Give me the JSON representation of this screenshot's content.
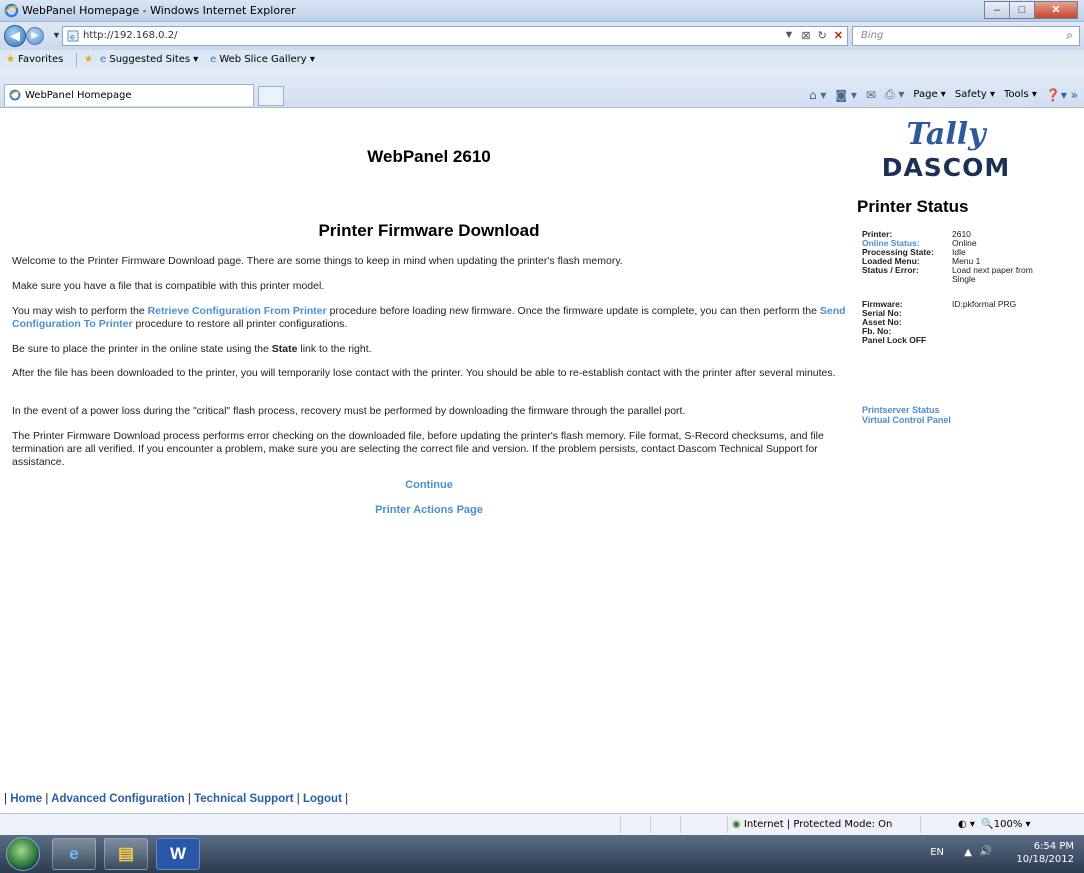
{
  "window": {
    "title": "WebPanel Homepage - Windows Internet Explorer",
    "min": "–",
    "max": "□",
    "close": "✕"
  },
  "address_bar": {
    "url": "http://192.168.0.2/",
    "search_placeholder": "Bing"
  },
  "favorites_bar": {
    "favorites": "Favorites",
    "suggested": "Suggested Sites ▾",
    "slice": "Web Slice Gallery ▾"
  },
  "tab": {
    "label": "WebPanel Homepage"
  },
  "command_bar": {
    "page": "Page ▾",
    "safety": "Safety ▾",
    "tools": "Tools ▾"
  },
  "main": {
    "title": "WebPanel 2610",
    "heading": "Printer Firmware Download",
    "p1": "Welcome to the Printer Firmware Download page. There are some things to keep in mind when updating the printer's flash memory.",
    "p2": "Make sure you have a file that is compatible with this printer model.",
    "p3a": "You may wish to perform the ",
    "p3_link1": "Retrieve Configuration From Printer",
    "p3b": " procedure before loading new firmware. Once the firmware update is complete, you can then perform the ",
    "p3_link2": "Send Configuration To Printer",
    "p3c": " procedure to restore all printer configurations.",
    "p4a": "Be sure to place the printer in the online state using the ",
    "p4_bold": "State",
    "p4b": " link to the right.",
    "p5": "After the file has been downloaded to the printer, you will temporarily lose contact with the printer. You should be able to re-establish contact with the printer after several minutes.",
    "p6": "In the event of a power loss during the \"critical\" flash process, recovery must be performed by downloading the firmware through the parallel port.",
    "p7": "The Printer Firmware Download process performs error checking on the downloaded file, before updating the printer's flash memory. File format, S-Record checksums, and file termination are all verified. If you encounter a problem, make sure you are selecting the correct file and version. If the problem persists, contact Dascom Technical Support for assistance.",
    "continue": "Continue",
    "actions": "Printer Actions Page"
  },
  "footer": {
    "sep": "|",
    "home": "Home",
    "advanced": "Advanced Configuration",
    "support": "Technical Support",
    "logout": "Logout"
  },
  "sidebar": {
    "logo_top": "Tally",
    "logo_bottom": "DASCOM",
    "status_title": "Printer Status",
    "printer_k": "Printer:",
    "printer_v": "2610",
    "online_k": "Online Status:",
    "online_v": "Online",
    "proc_k": "Processing State:",
    "proc_v": "Idle",
    "menu_k": "Loaded Menu:",
    "menu_v": "Menu 1",
    "err_k": "Status / Error:",
    "err_v1": "Load next paper from",
    "err_v2": "Single",
    "fw_k": "Firmware:",
    "fw_v": "ID:pkformal PRG",
    "serial_k": "Serial No:",
    "asset_k": "Asset No:",
    "fb_k": "Fb. No:",
    "lock_k": "Panel Lock OFF",
    "printserver": "Printserver Status",
    "vcp": "Virtual Control Panel"
  },
  "statusbar": {
    "zone": "Internet | Protected Mode: On",
    "zoom": "100%"
  },
  "taskbar": {
    "lang": "EN",
    "time": "6:54 PM",
    "date": "10/18/2012",
    "word": "W"
  }
}
